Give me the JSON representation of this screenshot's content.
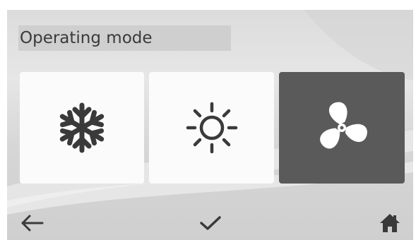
{
  "header": {
    "title": "Operating mode"
  },
  "modes": [
    {
      "id": "cool",
      "icon": "snowflake-icon",
      "selected": false
    },
    {
      "id": "heat",
      "icon": "sun-icon",
      "selected": false
    },
    {
      "id": "fan",
      "icon": "fan-icon",
      "selected": true
    }
  ],
  "footer": {
    "back_icon": "arrow-left-icon",
    "confirm_icon": "checkmark-icon",
    "home_icon": "home-icon"
  },
  "colors": {
    "selected_tile": "#5a5a5a",
    "tile": "#fbfbfb",
    "icon_dark": "#3a3a3a",
    "icon_light": "#ffffff",
    "title_bg": "#cfcfcf"
  }
}
